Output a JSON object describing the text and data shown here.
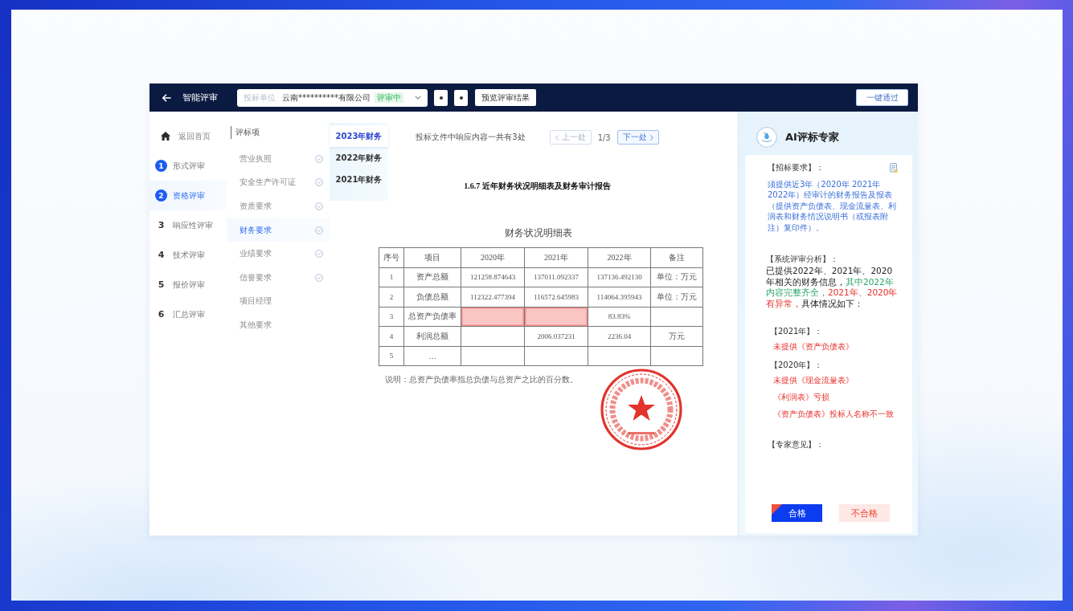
{
  "top_bar": {
    "title": "智能评审",
    "bidder_select": {
      "label": "投标单位",
      "value": "云南**********有限公司",
      "status": "评审中"
    },
    "preview_button": "预览评审结果",
    "approve_all_button": "一键通过"
  },
  "nav": {
    "home": "返回首页",
    "steps": [
      {
        "number": "1",
        "label": "形式评审",
        "reached": true,
        "selected": false
      },
      {
        "number": "2",
        "label": "资格评审",
        "reached": true,
        "selected": true
      },
      {
        "number": "3",
        "label": "响应性评审",
        "reached": false,
        "selected": false
      },
      {
        "number": "4",
        "label": "技术评审",
        "reached": false,
        "selected": false
      },
      {
        "number": "5",
        "label": "报价评审",
        "reached": false,
        "selected": false
      },
      {
        "number": "6",
        "label": "汇总评审",
        "reached": false,
        "selected": false
      }
    ]
  },
  "criteria": {
    "heading": "评标项",
    "items": [
      {
        "label": "营业执照",
        "checked": true,
        "selected": false
      },
      {
        "label": "安全生产许可证",
        "checked": true,
        "selected": false
      },
      {
        "label": "资质要求",
        "checked": true,
        "selected": false
      },
      {
        "label": "财务要求",
        "checked": true,
        "selected": true
      },
      {
        "label": "业绩要求",
        "checked": true,
        "selected": false
      },
      {
        "label": "信誉要求",
        "checked": true,
        "selected": false
      },
      {
        "label": "项目经理",
        "checked": false,
        "selected": false
      },
      {
        "label": "其他要求",
        "checked": false,
        "selected": false
      }
    ]
  },
  "year_tabs": [
    {
      "label": "2023年财务",
      "selected": true
    },
    {
      "label": "2022年财务",
      "selected": false
    },
    {
      "label": "2021年财务",
      "selected": false
    }
  ],
  "pager": {
    "summary": "投标文件中响应内容一共有3处",
    "prev": {
      "label": "上一处",
      "disabled": true
    },
    "position": "1/3",
    "next": {
      "label": "下一处",
      "disabled": false
    }
  },
  "document": {
    "section_title": "1.6.7 近年财务状况明细表及财务审计报告",
    "table_title": "财务状况明细表",
    "columns": [
      "序号",
      "项目",
      "2020年",
      "2021年",
      "2022年",
      "备注"
    ],
    "rows": [
      {
        "cells": [
          {
            "text": "1",
            "flagged": false
          },
          {
            "text": "资产总额",
            "flagged": false
          },
          {
            "text": "121258.874643",
            "flagged": false
          },
          {
            "text": "137011.092337",
            "flagged": false
          },
          {
            "text": "137136.492130",
            "flagged": false
          },
          {
            "text": "单位：万元",
            "flagged": false
          }
        ]
      },
      {
        "cells": [
          {
            "text": "2",
            "flagged": false
          },
          {
            "text": "负债总额",
            "flagged": false
          },
          {
            "text": "112322.477394",
            "flagged": false
          },
          {
            "text": "116572.645983",
            "flagged": false
          },
          {
            "text": "114064.395943",
            "flagged": false
          },
          {
            "text": "单位：万元",
            "flagged": false
          }
        ]
      },
      {
        "cells": [
          {
            "text": "3",
            "flagged": false
          },
          {
            "text": "总资产负债率",
            "flagged": false
          },
          {
            "flagged": true
          },
          {
            "flagged": true
          },
          {
            "text": "83.83%",
            "flagged": false
          },
          {
            "flagged": false
          }
        ]
      },
      {
        "cells": [
          {
            "text": "4",
            "flagged": false
          },
          {
            "text": "利润总额",
            "flagged": false
          },
          {
            "flagged": false
          },
          {
            "text": "2006.037231",
            "flagged": false
          },
          {
            "text": "2236.04",
            "flagged": false
          },
          {
            "text": "万元",
            "flagged": false
          }
        ]
      },
      {
        "cells": [
          {
            "text": "5",
            "flagged": false
          },
          {
            "text": "…",
            "flagged": false
          },
          {
            "flagged": false
          },
          {
            "flagged": false
          },
          {
            "flagged": false
          },
          {
            "flagged": false
          }
        ]
      }
    ],
    "note": "说明：总资产负债率指总负债与总资产之比的百分数。"
  },
  "ai_panel": {
    "title": "AI评标专家",
    "requirement": {
      "heading": "【招标要求】：",
      "text": "须提供近3年（2020年 2021年 2022年）经审计的财务报告及报表（提供资产负债表、现金流量表、利润表和财务情况说明书（或报表附注）复印件）。"
    },
    "analysis": {
      "heading": "【系统评审分析】：",
      "segments": [
        {
          "text": "已提供2022年、2021年、2020年相关的财务信息，"
        },
        {
          "text": "其中2022年内容完整齐全，",
          "color": "#2aa66a"
        },
        {
          "text": "2021年、2020年有异常，",
          "color": "#e5302b"
        },
        {
          "text": "具体情况如下："
        }
      ]
    },
    "findings": [
      {
        "year": "【2021年】：",
        "issues": [
          "未提供《资产负债表》"
        ]
      },
      {
        "year": "【2020年】：",
        "issues": [
          "未提供《现金流量表》",
          "《利润表》亏损",
          "《资产负债表》投标人名称不一致"
        ]
      }
    ],
    "expert_opinion": {
      "heading": "【专家意见】："
    },
    "verdict_buttons": [
      {
        "kind": "pass",
        "label": "合格",
        "selected": true
      },
      {
        "kind": "fail",
        "label": "不合格",
        "selected": false
      }
    ]
  }
}
